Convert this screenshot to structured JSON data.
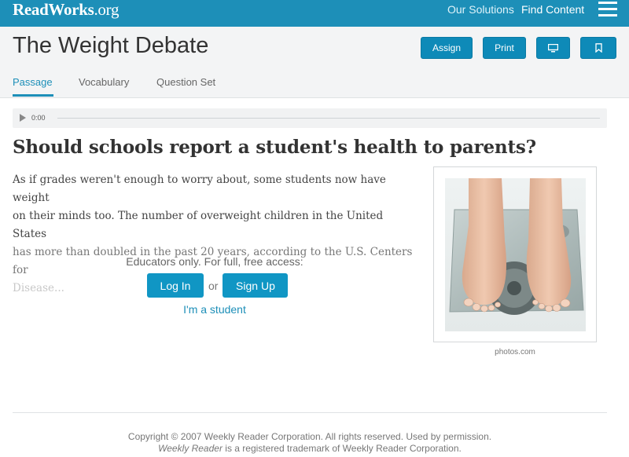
{
  "nav": {
    "logo_main": "ReadWorks",
    "logo_tld": ".org",
    "links": [
      "Our Solutions",
      "Find Content"
    ],
    "menu_icon": "hamburger-menu-icon"
  },
  "header": {
    "title": "The Weight Debate",
    "buttons": {
      "assign": "Assign",
      "print": "Print",
      "present_icon": "monitor-icon",
      "bookmark_icon": "bookmark-icon"
    },
    "tabs": [
      "Passage",
      "Vocabulary",
      "Question Set"
    ],
    "active_tab": "Passage"
  },
  "audio": {
    "time": "0:00",
    "play_icon": "play-icon"
  },
  "article": {
    "headline": "Should schools report a student's health to parents?",
    "line1": "As if grades weren't enough to worry about, some students now have weight",
    "line2": "on their minds too. The number of overweight children in the United States",
    "line3": "has more than doubled in the past 20 years, according to the U.S. Centers for",
    "line4": "Disease..."
  },
  "access": {
    "prompt": "Educators only. For full, free access:",
    "login": "Log In",
    "or": "or",
    "signup": "Sign Up",
    "student": "I'm a student"
  },
  "image": {
    "caption": "photos.com"
  },
  "footer": {
    "line1": "Copyright © 2007 Weekly Reader Corporation. All rights reserved. Used by permission.",
    "brand": "Weekly Reader",
    "line2_rest": " is a registered trademark of Weekly Reader Corporation."
  },
  "colors": {
    "brand": "#1d8fb8",
    "button": "#0e8ab8"
  }
}
